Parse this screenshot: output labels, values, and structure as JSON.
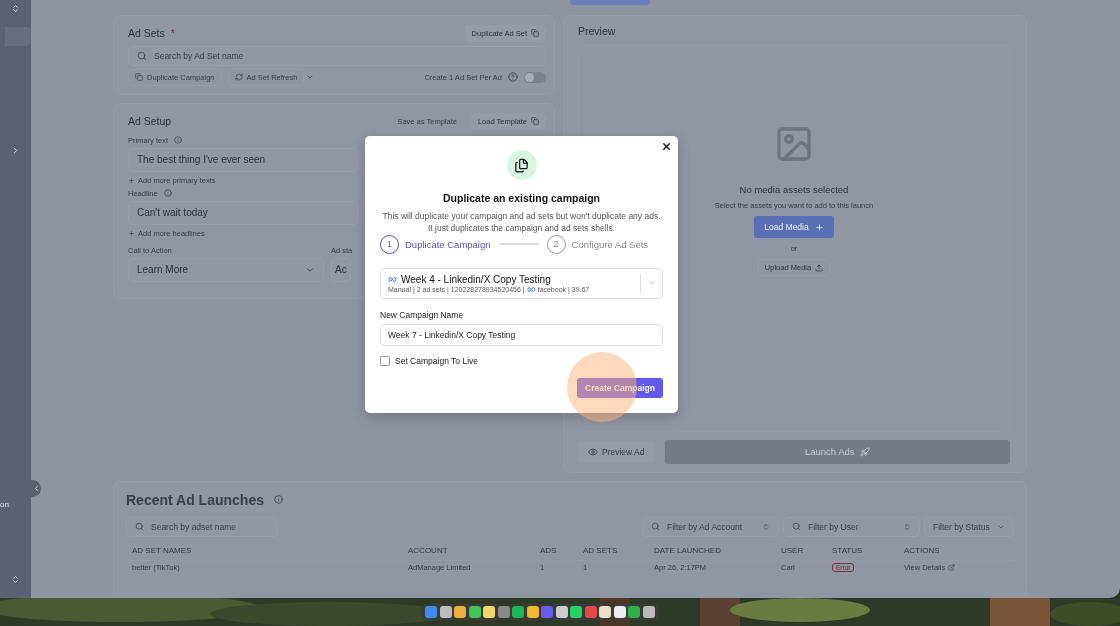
{
  "sidebar": {
    "label": "on"
  },
  "ad_sets": {
    "title": "Ad Sets",
    "required_mark": "*",
    "duplicate_button": "Duplicate Ad Set",
    "search_placeholder": "Search by Ad Set name",
    "actions": [
      "Duplicate Campaign",
      "Ad Set Refresh"
    ],
    "per_ad_label": "Create 1 Ad Set Per Ad",
    "per_ad_on": false
  },
  "ad_setup": {
    "title": "Ad Setup",
    "save_template": "Save as Template",
    "load_template": "Load Template",
    "primary_label": "Primary text",
    "primary_value": "The best thing I've ever seen",
    "add_primary": "Add more primary texts",
    "headline_label": "Headline",
    "headline_value": "Can't wait today",
    "add_headline": "Add more headlines",
    "cta_label": "Call to Action",
    "cta_value": "Learn More",
    "status_label": "Ad sta",
    "status_value": "Ac"
  },
  "preview": {
    "title": "Preview",
    "empty_title": "No media assets selected",
    "empty_text": "Select the assets you want to add to this launch",
    "load_button": "Load Media",
    "or": "or",
    "upload_button": "Upload Media",
    "preview_button": "Preview Ad",
    "launch_button": "Launch Ads"
  },
  "recent": {
    "title": "Recent Ad Launches",
    "search_placeholder": "Search by adset name",
    "filters": [
      {
        "kind": "search",
        "placeholder": "Filter by Ad Account"
      },
      {
        "kind": "search",
        "placeholder": "Filter by User"
      },
      {
        "kind": "select",
        "placeholder": "Filter by Status"
      }
    ],
    "columns": [
      "AD SET NAMES",
      "ACCOUNT",
      "ADS",
      "AD SETS",
      "DATE LAUNCHED",
      "USER",
      "STATUS",
      "ACTIONS"
    ],
    "rows": [
      {
        "name": "better (TikTok)",
        "account": "AdManage Limited",
        "ads": "1",
        "ad_sets": "1",
        "date": "Apr 26, 2:17PM",
        "user": "Carl",
        "status": "Error",
        "action": "View Details"
      }
    ]
  },
  "modal": {
    "title": "Duplicate an existing campaign",
    "description": "This will duplicate your campaign and ad sets but won't duplicate any ads. It just duplicates the campaign and ad sets shells.",
    "steps": [
      {
        "number": "1",
        "label": "Duplicate Campaign",
        "selected": true
      },
      {
        "number": "2",
        "label": "Configure Ad Sets",
        "selected": false
      }
    ],
    "campaign": {
      "name": "Week 4 - Linkedin/X Copy Testing",
      "details": "Manual | 2 ad sets | 120228278934520456 |",
      "platform": "facebook | 39.67"
    },
    "name_label": "New Campaign Name",
    "name_value": "Week 7 - Linkedin/X Copy Testing",
    "live_label": "Set Campaign To Live",
    "live_checked": false,
    "create_button": "Create Campaign"
  }
}
